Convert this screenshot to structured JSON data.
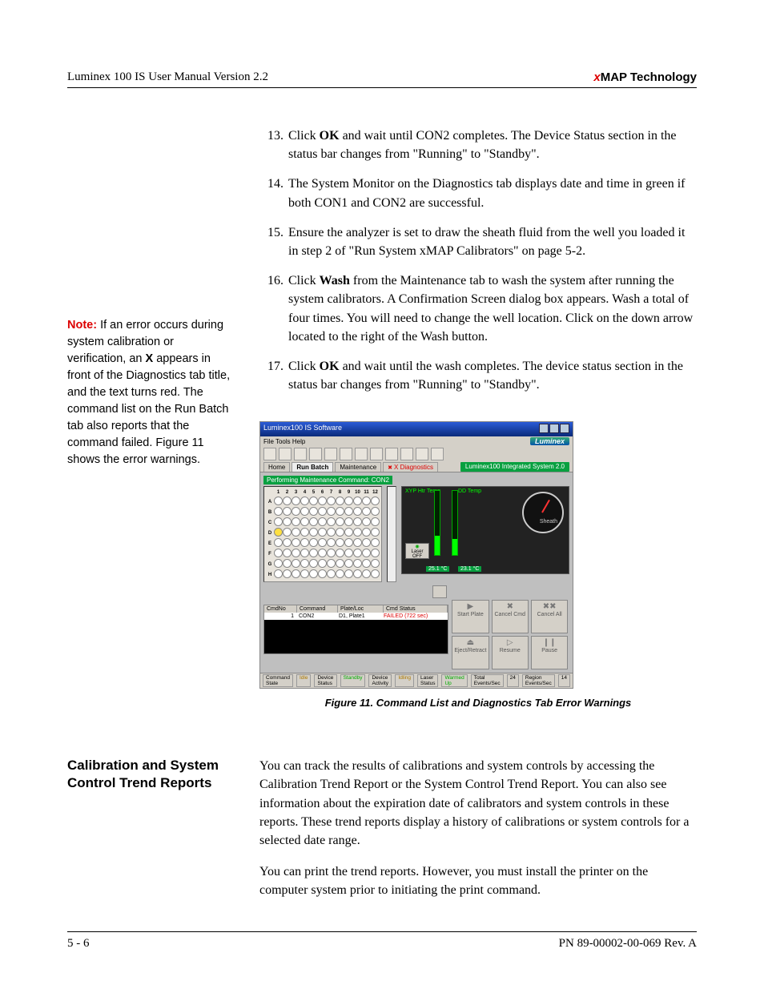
{
  "header": {
    "left": "Luminex 100 IS User Manual Version 2.2",
    "right_prefix": "x",
    "right_rest": "MAP Technology"
  },
  "sidebar_note": {
    "label": "Note:",
    "body_part1": " If an error occurs during system calibration or verification, an ",
    "bold_x": "X",
    "body_part2": " appears in front of the Diagnostics tab title, and the text turns red. The command list on the Run Batch tab also reports that the command failed. Figure 11 shows the error warnings."
  },
  "steps": [
    {
      "n": "13.",
      "pre": "Click ",
      "b": "OK",
      "post": " and wait until CON2 completes. The Device Status section in the status bar changes from \"Running\" to \"Standby\"."
    },
    {
      "n": "14.",
      "pre": "",
      "b": "",
      "post": "The System Monitor on the Diagnostics tab displays date and time in green if both CON1 and CON2 are successful."
    },
    {
      "n": "15.",
      "pre": "",
      "b": "",
      "post": "Ensure the analyzer is set to draw the sheath fluid from the well you loaded it in step 2 of \"Run System xMAP Calibrators\" on page 5-2."
    },
    {
      "n": "16.",
      "pre": "Click ",
      "b": "Wash",
      "post": " from the Maintenance tab to wash the system after running the system calibrators. A Confirmation Screen dialog box appears. Wash a total of four times. You will need to change the well location. Click on the down arrow located to the right of the Wash button."
    },
    {
      "n": "17.",
      "pre": "Click ",
      "b": "OK",
      "post": " and wait until the wash completes. The device status section in the status bar changes from \"Running\" to \"Standby\"."
    }
  ],
  "figure_caption": "Figure 11.  Command List and Diagnostics Tab Error Warnings",
  "shot": {
    "title": "Luminex100 IS Software",
    "menu": "File  Tools  Help",
    "brand": "Luminex",
    "tabs": [
      "Home",
      "Run Batch",
      "Maintenance"
    ],
    "tab_diag": "X Diagnostics",
    "sys_name": "Luminex100 Integrated System 2.0",
    "cmd_label": "Performing Maintenance Command: CON2",
    "plate_cols": [
      "1",
      "2",
      "3",
      "4",
      "5",
      "6",
      "7",
      "8",
      "9",
      "10",
      "11",
      "12"
    ],
    "plate_rows": [
      "A",
      "B",
      "C",
      "D",
      "E",
      "F",
      "G",
      "H"
    ],
    "gauge_labels": {
      "xyp": "XYP Htr Temp",
      "dd": "DD Temp",
      "sheath": "Sheath",
      "laser_btn": "Laser OFF"
    },
    "gauge_read_left": "25.1 °C",
    "gauge_read_right": "23.1 °C",
    "cmd_headers": [
      "CmdNo",
      "Command",
      "Plate/Loc",
      "Cmd Status"
    ],
    "cmd_row": [
      "1",
      "CON2",
      "D1, Plate1",
      "FAILED (722 sec)"
    ],
    "buttons": [
      "Start Plate",
      "Cancel Cmd",
      "Cancel All",
      "Eject/Retract",
      "Resume",
      "Pause"
    ],
    "status": {
      "cs": "Command State",
      "cs_v": "Idle",
      "ds": "Device Status",
      "ds_v": "Standby",
      "da": "Device Activity",
      "da_v": "Idling",
      "ls": "Laser Status",
      "ls_v": "Warmed Up",
      "te": "Total Events/Sec",
      "te_v": "24",
      "re": "Region Events/Sec",
      "re_v": "14"
    }
  },
  "section2": {
    "heading": "Calibration and System Control Trend Reports",
    "p1": "You can track the results of calibrations and system controls by accessing the Calibration Trend Report or the System Control Trend Report. You can also see information about the expiration date of calibrators and system controls in these reports. These trend reports display a history of calibrations or system controls for a selected date range.",
    "p2": "You can print the trend reports. However, you must install the printer on the computer system prior to initiating the print command."
  },
  "footer": {
    "left": "5 - 6",
    "right": "PN 89-00002-00-069 Rev. A"
  }
}
